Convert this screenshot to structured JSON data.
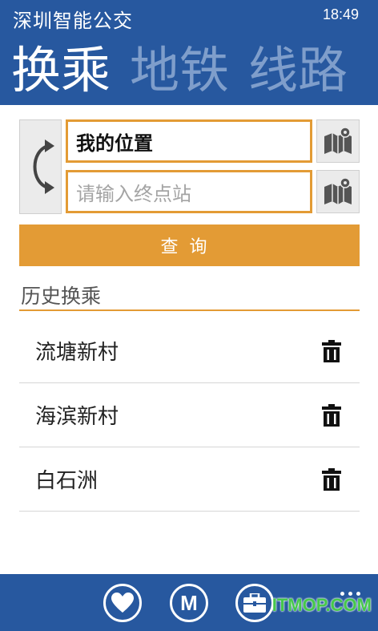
{
  "status": {
    "time": "18:49"
  },
  "app": {
    "title": "深圳智能公交"
  },
  "pivot": {
    "tabs": [
      {
        "label": "换乘",
        "active": true
      },
      {
        "label": "地铁",
        "active": false
      },
      {
        "label": "线路",
        "active": false
      }
    ]
  },
  "route": {
    "start_value": "我的位置",
    "end_placeholder": "请输入终点站",
    "query_label": "查询"
  },
  "history": {
    "title": "历史换乘",
    "items": [
      "流塘新村",
      "海滨新村",
      "白石洲"
    ]
  },
  "appbar": {
    "metro_glyph": "M",
    "buttons": [
      "heart-icon",
      "metro-icon",
      "briefcase-icon"
    ]
  },
  "watermark": "ITMOP.COM",
  "colors": {
    "primary": "#27589f",
    "accent": "#e39b35",
    "inactive_tab": "#7f9ecb"
  }
}
